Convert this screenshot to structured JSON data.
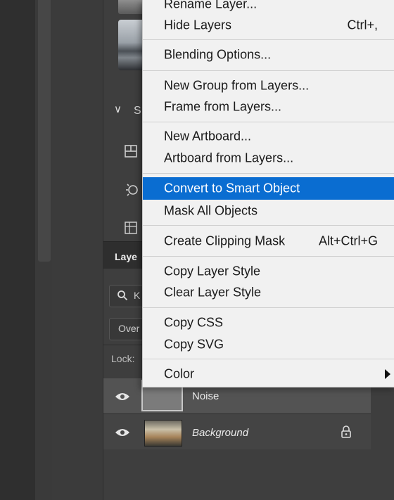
{
  "panel": {
    "section_label": "S",
    "layers_title": "Laye",
    "search_text": "K",
    "blend_text": "Over",
    "lock_text": "Lock:"
  },
  "layers": [
    {
      "name": "Noise",
      "visible": true
    },
    {
      "name": "Background",
      "visible": true,
      "locked": true
    }
  ],
  "context_menu": {
    "items": [
      {
        "label": "Rename Layer...",
        "shortcut": ""
      },
      {
        "label": "Hide Layers",
        "shortcut": "Ctrl+,"
      },
      {
        "label": "Blending Options...",
        "shortcut": ""
      },
      {
        "label": "New Group from Layers...",
        "shortcut": ""
      },
      {
        "label": "Frame from Layers...",
        "shortcut": ""
      },
      {
        "label": "New Artboard...",
        "shortcut": ""
      },
      {
        "label": "Artboard from Layers...",
        "shortcut": ""
      },
      {
        "label": "Convert to Smart Object",
        "shortcut": "",
        "highlighted": true
      },
      {
        "label": "Mask All Objects",
        "shortcut": ""
      },
      {
        "label": "Create Clipping Mask",
        "shortcut": "Alt+Ctrl+G"
      },
      {
        "label": "Copy Layer Style",
        "shortcut": ""
      },
      {
        "label": "Clear Layer Style",
        "shortcut": ""
      },
      {
        "label": "Copy CSS",
        "shortcut": ""
      },
      {
        "label": "Copy SVG",
        "shortcut": ""
      },
      {
        "label": "Color",
        "shortcut": "",
        "submenu": true
      }
    ]
  },
  "colors": {
    "highlight": "#0a6dd1",
    "menu_bg": "#f1f1f1",
    "panel_bg": "#3e3e3e"
  }
}
